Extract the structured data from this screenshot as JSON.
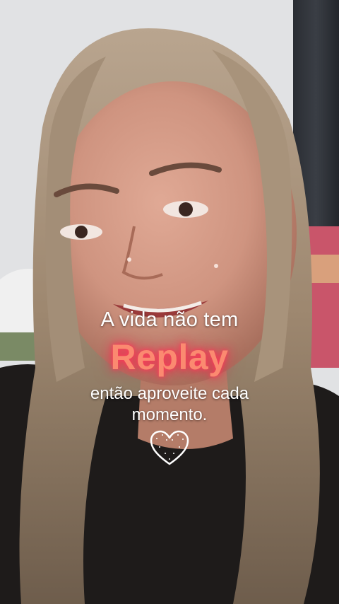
{
  "overlay": {
    "line1": "A vida não tem",
    "highlight": "Replay",
    "line2": "então aproveite cada",
    "line3": "momento.",
    "heart_icon": "heart-outline-icon"
  },
  "colors": {
    "highlight": "#fb8a70",
    "glow": "#ff2c5a",
    "text": "#ffffff"
  }
}
